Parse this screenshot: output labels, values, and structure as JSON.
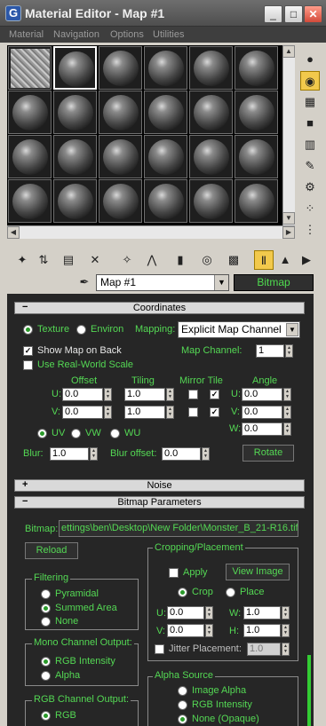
{
  "window": {
    "title": "Material Editor - Map #1",
    "controls": [
      "minimize",
      "maximize",
      "close"
    ]
  },
  "menu": [
    "Material",
    "Navigation",
    "Options",
    "Utilities"
  ],
  "slots": {
    "rows": 4,
    "cols": 6,
    "active_index": 1,
    "texture_index": 0
  },
  "side_toolbar": [
    "sample-type-icon",
    "backlight-icon",
    "background-icon",
    "sample-uv-tiling-icon",
    "video-color-check-icon",
    "make-preview-icon",
    "options-icon",
    "select-by-material-icon",
    "material-map-navigator-icon"
  ],
  "bottom_toolbar": [
    "get-material-icon",
    "put-to-scene-icon",
    "assign-material-icon",
    "reset-map-icon",
    "copy-material-icon",
    "make-unique-icon",
    "put-to-library-icon",
    "material-id-channel-icon",
    "show-map-in-viewport-icon",
    "show-end-result-icon",
    "go-to-parent-icon",
    "go-forward-to-sibling-icon"
  ],
  "map_name": {
    "value": "Map #1",
    "type_button": "Bitmap"
  },
  "coordinates": {
    "header": "Coordinates",
    "toggle": "−",
    "texture_label": "Texture",
    "environ_label": "Environ",
    "mapping_label": "Mapping:",
    "mapping_value": "Explicit Map Channel",
    "show_map_on_back": "Show Map on Back",
    "map_channel_label": "Map Channel:",
    "map_channel_value": "1",
    "use_real_world_scale": "Use Real-World Scale",
    "headers": {
      "offset": "Offset",
      "tiling": "Tiling",
      "mirror_tile": "Mirror Tile",
      "angle": "Angle"
    },
    "u_label": "U:",
    "v_label": "V:",
    "w_label": "W:",
    "offset_u": "0.0",
    "offset_v": "0.0",
    "tiling_u": "1.0",
    "tiling_v": "1.0",
    "angle_u": "0.0",
    "angle_v": "0.0",
    "angle_w": "0.0",
    "uv_label": "UV",
    "vw_label": "VW",
    "wu_label": "WU",
    "blur_label": "Blur:",
    "blur_value": "1.0",
    "blur_offset_label": "Blur offset:",
    "blur_offset_value": "0.0",
    "rotate_button": "Rotate"
  },
  "noise": {
    "header": "Noise",
    "toggle": "+"
  },
  "bitmap_params": {
    "header": "Bitmap Parameters",
    "toggle": "−",
    "bitmap_label": "Bitmap:",
    "bitmap_path": "ettings\\ben\\Desktop\\New Folder\\Monster_B_21-R16.tif",
    "reload_button": "Reload",
    "cropping_title": "Cropping/Placement",
    "apply_label": "Apply",
    "view_image_button": "View Image",
    "crop_label": "Crop",
    "place_label": "Place",
    "u_label": "U:",
    "v_label": "V:",
    "w_label": "W:",
    "h_label": "H:",
    "crop_u": "0.0",
    "crop_v": "0.0",
    "crop_w": "1.0",
    "crop_h": "1.0",
    "jitter_label": "Jitter Placement:",
    "jitter_value": "1.0",
    "filtering_title": "Filtering",
    "filter_pyramidal": "Pyramidal",
    "filter_summed": "Summed Area",
    "filter_none": "None",
    "mono_title": "Mono Channel Output:",
    "mono_rgb": "RGB Intensity",
    "mono_alpha": "Alpha",
    "rgb_title": "RGB Channel Output:",
    "rgb_rgb": "RGB",
    "alpha_source_title": "Alpha Source",
    "alpha_image": "Image Alpha",
    "alpha_rgb": "RGB Intensity",
    "alpha_none": "None (Opaque)"
  },
  "colors": {
    "label_green": "#54d854",
    "panel_bg": "#262626",
    "active_button": "#f2c94c"
  }
}
